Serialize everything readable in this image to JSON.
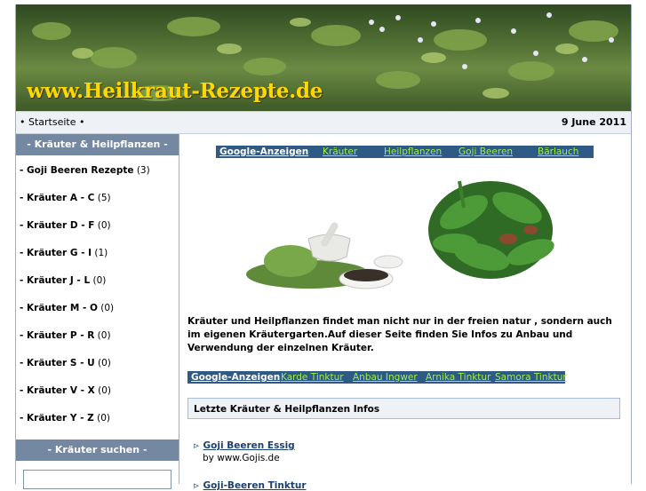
{
  "banner": {
    "title": "www.Heilkraut-Rezepte.de"
  },
  "topbar": {
    "breadcrumb": "• Startseite •",
    "date": "9 June 2011"
  },
  "sidebar": {
    "heading": "- Kräuter & Heilpflanzen -",
    "items": [
      {
        "label": "- Goji Beeren Rezepte",
        "count": "(3)"
      },
      {
        "label": "- Kräuter A - C",
        "count": "(5)"
      },
      {
        "label": "- Kräuter D - F",
        "count": "(0)"
      },
      {
        "label": "- Kräuter G - I",
        "count": "(1)"
      },
      {
        "label": "- Kräuter J - L",
        "count": "(0)"
      },
      {
        "label": "- Kräuter M - O",
        "count": "(0)"
      },
      {
        "label": "- Kräuter P - R",
        "count": "(0)"
      },
      {
        "label": "- Kräuter S - U",
        "count": "(0)"
      },
      {
        "label": "- Kräuter V - X",
        "count": "(0)"
      },
      {
        "label": "- Kräuter Y - Z",
        "count": "(0)"
      }
    ],
    "search_heading": "- Kräuter suchen -"
  },
  "ads_top": {
    "label": "Google-Anzeigen",
    "links": [
      "Kräuter",
      "Heilpflanzen",
      "Goji Beeren",
      "Bärlauch"
    ]
  },
  "intro": "Kräuter und Heilpflanzen findet man nicht nur in der freien natur , sondern auch im eigenen Kräutergarten.Auf dieser Seite finden Sie Infos zu Anbau und Verwendung der einzelnen Kräuter.",
  "ads_mid": {
    "label": "Google-Anzeigen",
    "links": [
      "Karde Tinktur",
      "Anbau Ingwer",
      "Arnika Tinktur",
      "Samora Tinktur"
    ]
  },
  "latest": {
    "heading": "Letzte Kräuter & Heilpflanzen Infos",
    "items": [
      {
        "title": "Goji Beeren Essig",
        "by": "by www.Gojis.de"
      },
      {
        "title": "Goji-Beeren Tinktur"
      }
    ]
  },
  "colors": {
    "accent": "#7488a1",
    "ad_bar": "#2f5a86",
    "ad_link": "#9cf04a",
    "banner_text": "#ffd800"
  }
}
